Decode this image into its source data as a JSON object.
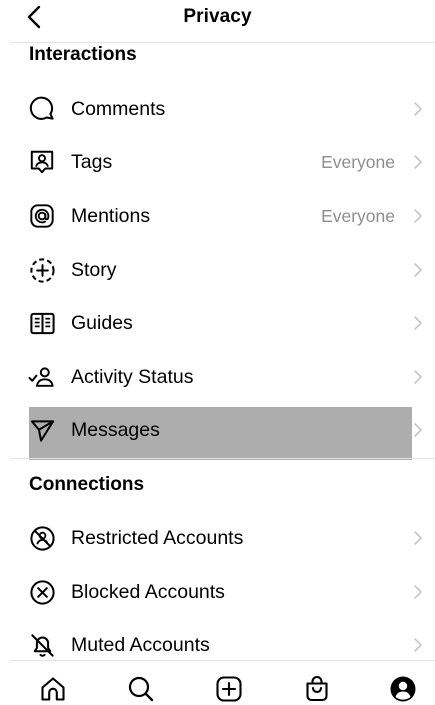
{
  "header": {
    "title": "Privacy"
  },
  "interactions": {
    "title": "Interactions",
    "items": [
      {
        "label": "Comments",
        "value": "",
        "icon": "comment-bubble-icon"
      },
      {
        "label": "Tags",
        "value": "Everyone",
        "icon": "tag-person-icon"
      },
      {
        "label": "Mentions",
        "value": "Everyone",
        "icon": "at-sign-icon"
      },
      {
        "label": "Story",
        "value": "",
        "icon": "story-add-icon"
      },
      {
        "label": "Guides",
        "value": "",
        "icon": "guides-book-icon"
      },
      {
        "label": "Activity Status",
        "value": "",
        "icon": "activity-status-icon"
      },
      {
        "label": "Messages",
        "value": "",
        "icon": "paper-plane-icon"
      }
    ]
  },
  "connections": {
    "title": "Connections",
    "items": [
      {
        "label": "Restricted Accounts",
        "value": "",
        "icon": "restricted-icon"
      },
      {
        "label": "Blocked Accounts",
        "value": "",
        "icon": "blocked-icon"
      },
      {
        "label": "Muted Accounts",
        "value": "",
        "icon": "muted-bell-icon"
      }
    ]
  },
  "bottom_nav": [
    "home-icon",
    "search-icon",
    "create-post-icon",
    "shop-bag-icon",
    "profile-icon"
  ],
  "colors": {
    "highlight": "#adadad",
    "secondary_text": "#8e8e8e",
    "chevron": "#c7c7cc",
    "divider": "#e3e3e3"
  }
}
